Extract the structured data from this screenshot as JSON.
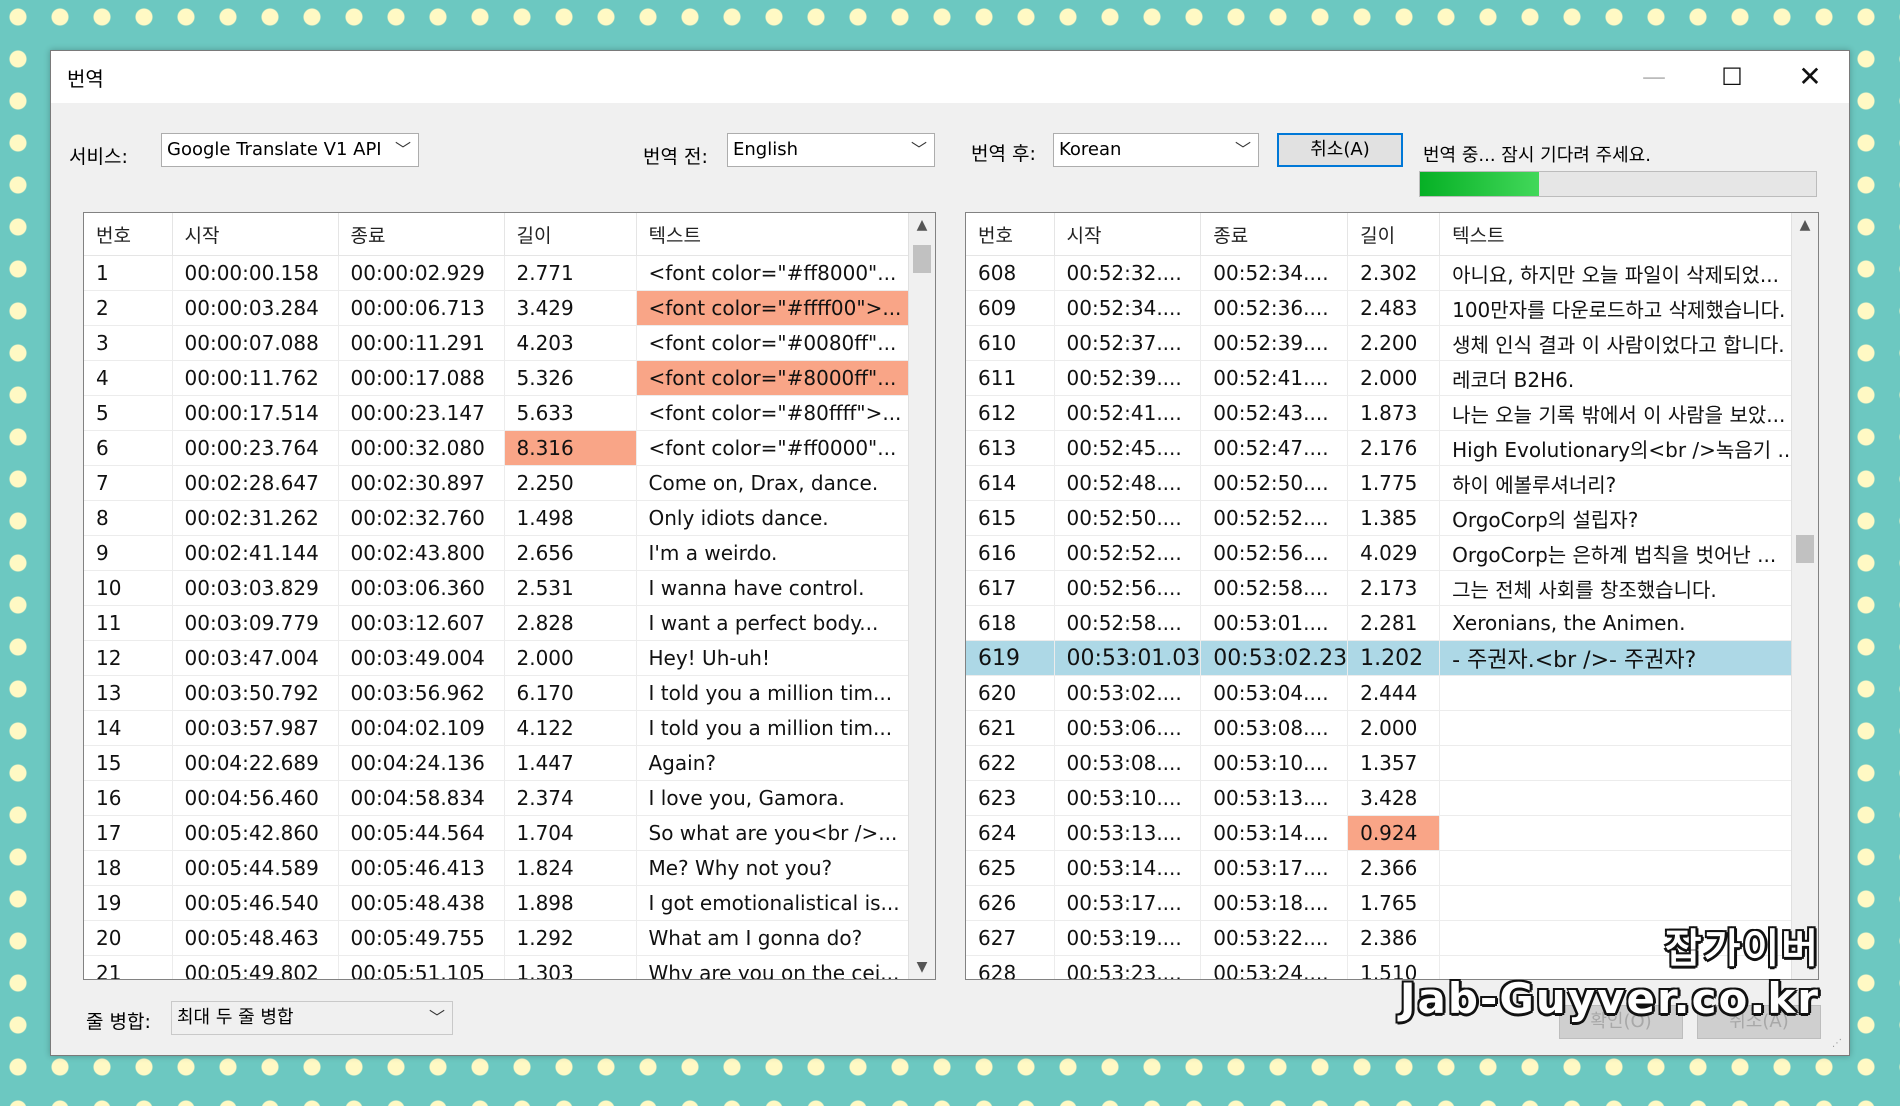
{
  "window": {
    "title": "번역",
    "minimize": "—",
    "maximize": "☐",
    "close": "✕"
  },
  "toolbar": {
    "service_label": "서비스:",
    "service_value": "Google Translate V1 API",
    "from_label": "번역 전:",
    "from_value": "English",
    "to_label": "번역 후:",
    "to_value": "Korean",
    "cancel_button": "취소(A)",
    "status": "번역 중... 잠시 기다려 주세요.",
    "progress": 0.3
  },
  "columns": {
    "num": "번호",
    "start": "시작",
    "end": "종료",
    "dur": "길이",
    "text": "텍스트"
  },
  "source_rows": [
    [
      "1",
      "00:00:00.158",
      "00:00:02.929",
      "2.771",
      "<font color=\"#ff8000\"..."
    ],
    [
      "2",
      "00:00:03.284",
      "00:00:06.713",
      "3.429",
      "<font color=\"#ffff00\">..."
    ],
    [
      "3",
      "00:00:07.088",
      "00:00:11.291",
      "4.203",
      "<font color=\"#0080ff\"..."
    ],
    [
      "4",
      "00:00:11.762",
      "00:00:17.088",
      "5.326",
      "<font color=\"#8000ff\"..."
    ],
    [
      "5",
      "00:00:17.514",
      "00:00:23.147",
      "5.633",
      "<font color=\"#80ffff\">..."
    ],
    [
      "6",
      "00:00:23.764",
      "00:00:32.080",
      "8.316",
      "<font color=\"#ff0000\"..."
    ],
    [
      "7",
      "00:02:28.647",
      "00:02:30.897",
      "2.250",
      "Come on, Drax, dance."
    ],
    [
      "8",
      "00:02:31.262",
      "00:02:32.760",
      "1.498",
      "Only idiots dance."
    ],
    [
      "9",
      "00:02:41.144",
      "00:02:43.800",
      "2.656",
      "I'm a weirdo."
    ],
    [
      "10",
      "00:03:03.829",
      "00:03:06.360",
      "2.531",
      "I wanna have control."
    ],
    [
      "11",
      "00:03:09.779",
      "00:03:12.607",
      "2.828",
      "I want a perfect body..."
    ],
    [
      "12",
      "00:03:47.004",
      "00:03:49.004",
      "2.000",
      "Hey! Uh-uh!"
    ],
    [
      "13",
      "00:03:50.792",
      "00:03:56.962",
      "6.170",
      "I told you a million tim..."
    ],
    [
      "14",
      "00:03:57.987",
      "00:04:02.109",
      "4.122",
      "I told you a million tim..."
    ],
    [
      "15",
      "00:04:22.689",
      "00:04:24.136",
      "1.447",
      "Again?"
    ],
    [
      "16",
      "00:04:56.460",
      "00:04:58.834",
      "2.374",
      "I love you, Gamora."
    ],
    [
      "17",
      "00:05:42.860",
      "00:05:44.564",
      "1.704",
      "So what are you<br />..."
    ],
    [
      "18",
      "00:05:44.589",
      "00:05:46.413",
      "1.824",
      "Me? Why not you?"
    ],
    [
      "19",
      "00:05:46.540",
      "00:05:48.438",
      "1.898",
      "I got emotionalistical is..."
    ],
    [
      "20",
      "00:05:48.463",
      "00:05:49.755",
      "1.292",
      "What am I gonna do?"
    ],
    [
      "21",
      "00:05:49.802",
      "00:05:51.105",
      "1.303",
      "Why are you on the cei..."
    ]
  ],
  "source_highlights": [
    [
      1,
      4
    ],
    [
      3,
      4
    ],
    [
      5,
      3
    ]
  ],
  "target_rows": [
    [
      "608",
      "00:52:32....",
      "00:52:34....",
      "2.302",
      "아니요, 하지만 오늘 파일이 삭제되었..."
    ],
    [
      "609",
      "00:52:34....",
      "00:52:36....",
      "2.483",
      "100만자를 다운로드하고 삭제했습니다."
    ],
    [
      "610",
      "00:52:37....",
      "00:52:39....",
      "2.200",
      "생체 인식 결과 이 사람이었다고 합니다."
    ],
    [
      "611",
      "00:52:39....",
      "00:52:41....",
      "2.000",
      "레코더 B2H6."
    ],
    [
      "612",
      "00:52:41....",
      "00:52:43....",
      "1.873",
      "나는 오늘 기록 밖에서 이 사람을 보았..."
    ],
    [
      "613",
      "00:52:45....",
      "00:52:47....",
      "2.176",
      "High Evolutionary의<br />녹음기 ..."
    ],
    [
      "614",
      "00:52:48....",
      "00:52:50....",
      "1.775",
      "하이 에볼루셔너리?"
    ],
    [
      "615",
      "00:52:50....",
      "00:52:52....",
      "1.385",
      "OrgoCorp의 설립자?"
    ],
    [
      "616",
      "00:52:52....",
      "00:52:56....",
      "4.029",
      "OrgoCorp는 은하계 법칙을 벗어난 ..."
    ],
    [
      "617",
      "00:52:56....",
      "00:52:58....",
      "2.173",
      "그는 전체 사회를 창조했습니다."
    ],
    [
      "618",
      "00:52:58....",
      "00:53:01....",
      "2.281",
      "Xeronians, the Animen."
    ],
    [
      "619",
      "00:53:01.03",
      "00:53:02.23",
      "1.202",
      "- 주권자.<br />- 주권자?"
    ],
    [
      "620",
      "00:53:02....",
      "00:53:04....",
      "2.444",
      ""
    ],
    [
      "621",
      "00:53:06....",
      "00:53:08....",
      "2.000",
      ""
    ],
    [
      "622",
      "00:53:08....",
      "00:53:10....",
      "1.357",
      ""
    ],
    [
      "623",
      "00:53:10....",
      "00:53:13....",
      "3.428",
      ""
    ],
    [
      "624",
      "00:53:13....",
      "00:53:14....",
      "0.924",
      ""
    ],
    [
      "625",
      "00:53:14....",
      "00:53:17....",
      "2.366",
      ""
    ],
    [
      "626",
      "00:53:17....",
      "00:53:18....",
      "1.765",
      ""
    ],
    [
      "627",
      "00:53:19....",
      "00:53:22....",
      "2.386",
      ""
    ],
    [
      "628",
      "00:53:23....",
      "00:53:24....",
      "1.510",
      ""
    ]
  ],
  "target_highlights": [
    [
      16,
      3
    ]
  ],
  "target_selected_index": 11,
  "bottom": {
    "merge_label": "줄 병합:",
    "merge_value": "최대 두 줄 병합",
    "ok_button": "확인(O)",
    "cancel_button": "취소(A)"
  },
  "watermark": {
    "korean": "잡가이버",
    "url": "Jab-Guyver.co.kr"
  },
  "colors": {
    "highlight": "#f9a587",
    "selected": "#add8e6",
    "progress": "#06b025"
  }
}
